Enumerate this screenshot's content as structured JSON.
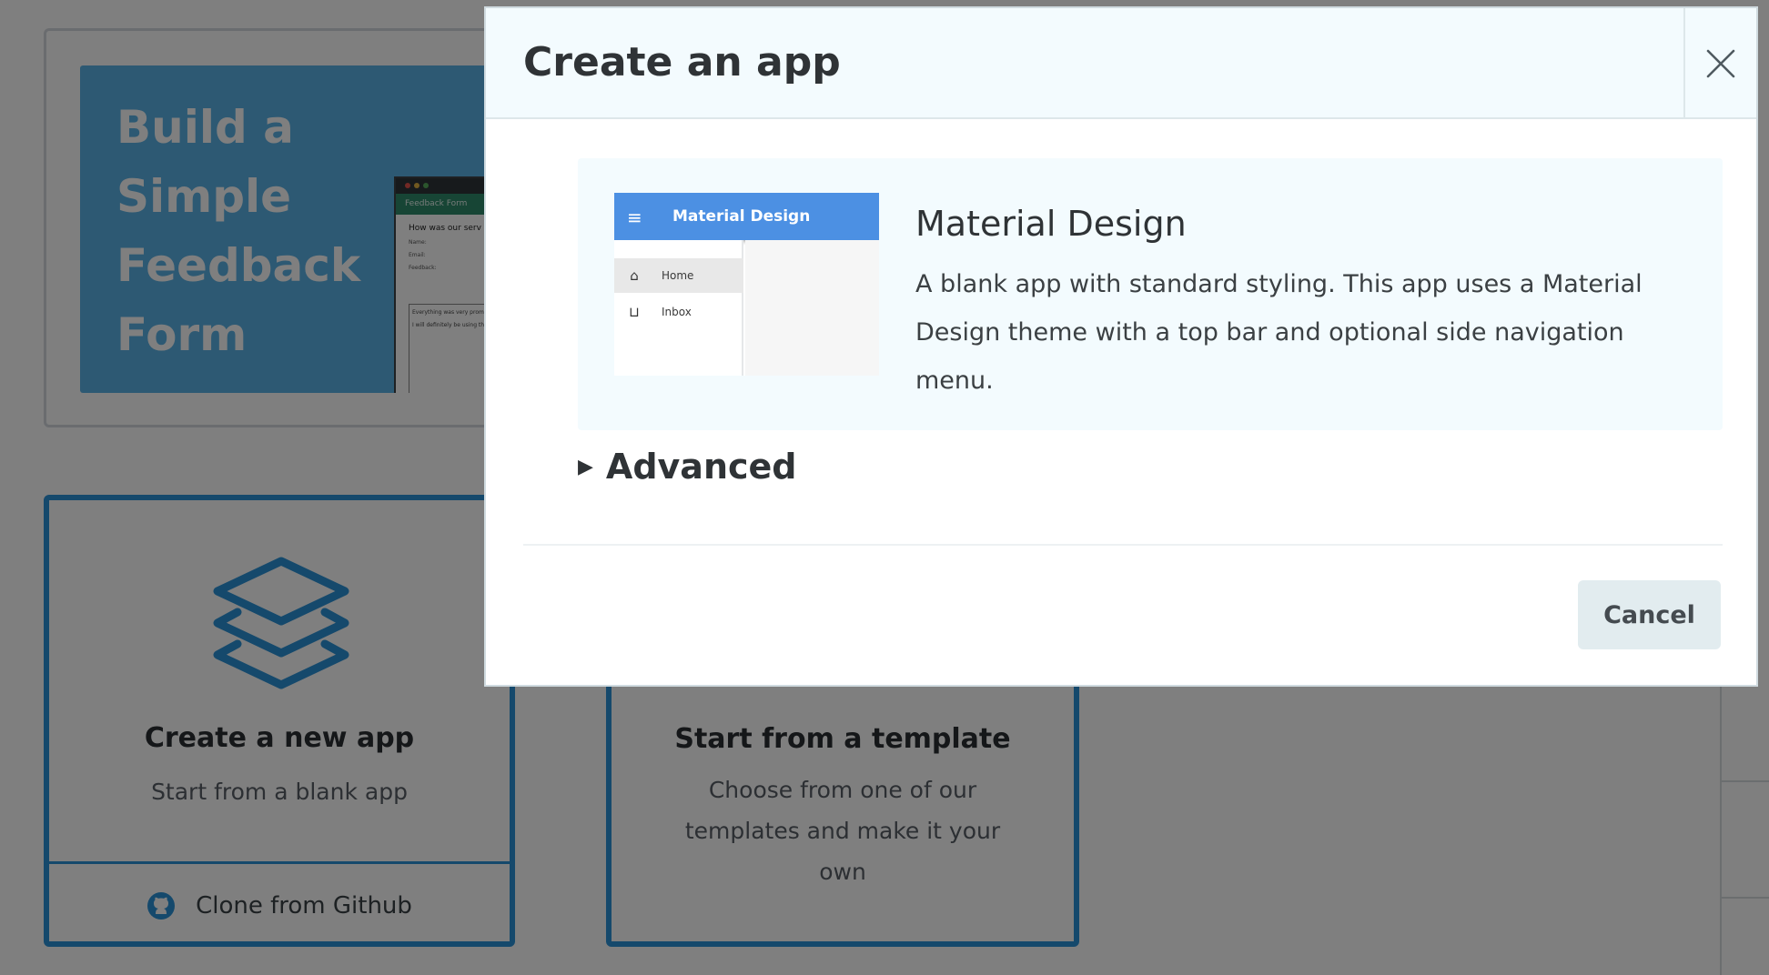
{
  "background": {
    "banner": {
      "title_lines": [
        "Build a Simple",
        "Feedback",
        "Form"
      ],
      "mock": {
        "bar_label": "Feedback Form",
        "question": "How was our serv",
        "fields": [
          "Name:",
          "Email:",
          "Feedback:"
        ],
        "textarea_lines": [
          "Everything was very prom",
          "I will definitely be using th"
        ]
      }
    },
    "create_card": {
      "title": "Create a new app",
      "subtitle": "Start from a blank app",
      "clone_label": "Clone from Github",
      "icon": "layers-icon"
    },
    "template_card": {
      "title": "Start from a template",
      "subtitle_lines": [
        "Choose from one of our",
        "templates and make it your",
        "own"
      ]
    },
    "accent_color": "#2b93d8"
  },
  "modal": {
    "title": "Create an app",
    "close_icon": "close-icon",
    "template": {
      "name": "Material Design",
      "description": "A blank app with standard styling. This app uses a Material Design theme with a top bar and optional side navigation menu.",
      "thumbnail": {
        "menu_icon": "≡",
        "bar_title": "Material Design",
        "items": [
          {
            "icon": "home-icon",
            "glyph": "⌂",
            "label": "Home"
          },
          {
            "icon": "inbox-icon",
            "glyph": "⊔",
            "label": "Inbox"
          }
        ],
        "bar_color": "#4c90e3"
      }
    },
    "advanced_label": "Advanced",
    "cancel_label": "Cancel"
  }
}
